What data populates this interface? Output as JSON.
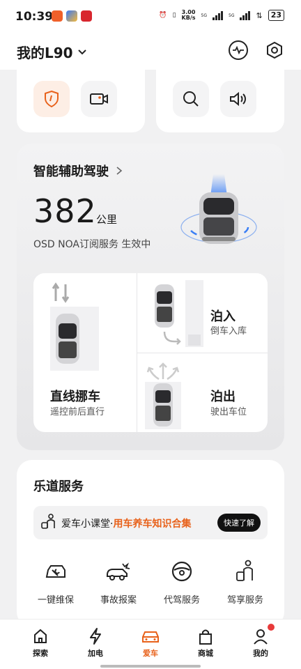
{
  "status_bar": {
    "time": "10:39",
    "net_speed": "3.00",
    "net_unit": "KB/s",
    "signal_5g_a": "5G",
    "signal_5g_b": "5G",
    "battery": "23"
  },
  "header": {
    "car_name": "我的L90",
    "icons": [
      "pulse-icon",
      "settings-hexagon-icon"
    ]
  },
  "quick_actions": {
    "left": [
      "shield-icon",
      "dashcam-icon"
    ],
    "right": [
      "search-icon",
      "speaker-icon"
    ]
  },
  "adas": {
    "title": "智能辅助驾驶",
    "range_value": "382",
    "range_unit": "公里",
    "status": "OSD NOA订阅服务 生效中",
    "park_straight_title": "直线挪车",
    "park_straight_sub": "遥控前后直行",
    "park_in_title": "泊入",
    "park_in_sub": "倒车入库",
    "park_out_title": "泊出",
    "park_out_sub": "驶出车位"
  },
  "service": {
    "title": "乐道服务",
    "banner_prefix": "爱车小课堂·",
    "banner_highlight": "用车养车知识合集",
    "banner_button": "快速了解",
    "items": [
      {
        "label": "一键维保",
        "icon": "wrench-car-icon"
      },
      {
        "label": "事故报案",
        "icon": "accident-car-icon"
      },
      {
        "label": "代驾服务",
        "icon": "steering-wheel-icon"
      },
      {
        "label": "驾享服务",
        "icon": "person-car-icon"
      }
    ]
  },
  "tabs": [
    {
      "label": "探索",
      "icon": "home-icon"
    },
    {
      "label": "加电",
      "icon": "lightning-icon"
    },
    {
      "label": "爱车",
      "icon": "car-icon",
      "active": true
    },
    {
      "label": "商城",
      "icon": "bag-icon"
    },
    {
      "label": "我的",
      "icon": "person-icon"
    }
  ],
  "colors": {
    "accent": "#e8611a",
    "badge": "#e83a3a"
  }
}
